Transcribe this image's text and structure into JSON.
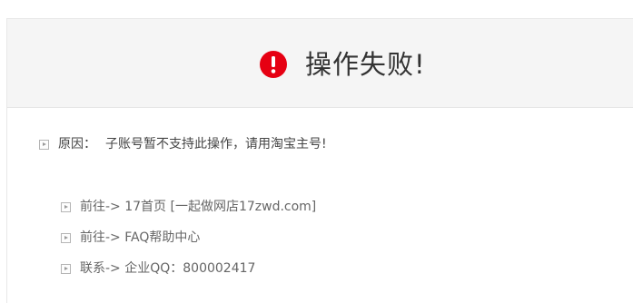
{
  "header": {
    "title": "操作失败!",
    "icon": "alert-circle-icon",
    "icon_color": "#e60012"
  },
  "reason": {
    "label": "原因：",
    "text": "子账号暂不支持此操作，请用淘宝主号!",
    "icon": "play-square-icon"
  },
  "links": [
    {
      "text": "前往-> 17首页 [一起做网店17zwd.com]",
      "icon": "play-square-icon"
    },
    {
      "text": "前往-> FAQ帮助中心",
      "icon": "play-square-icon"
    },
    {
      "text": "联系-> 企业QQ：800002417",
      "icon": "play-square-icon"
    }
  ]
}
